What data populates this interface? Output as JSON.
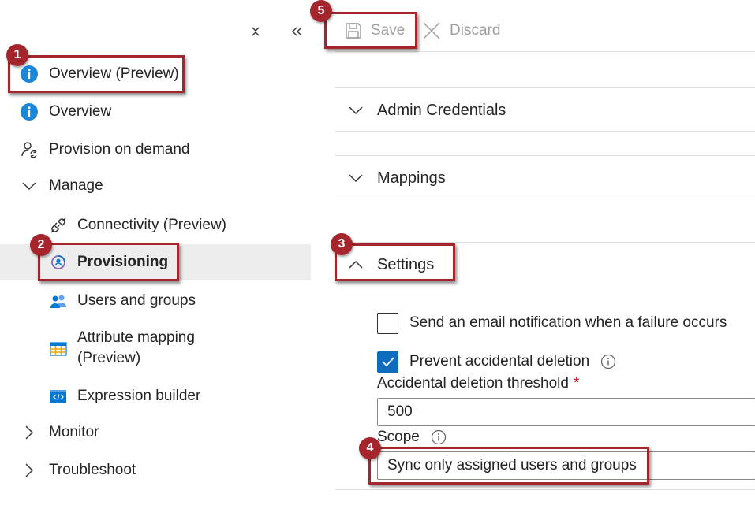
{
  "nav": {
    "items": [
      {
        "label": "Overview (Preview)",
        "icon": "info-icon"
      },
      {
        "label": "Overview",
        "icon": "info-icon"
      },
      {
        "label": "Provision on demand",
        "icon": "provision-on-demand-icon"
      },
      {
        "label": "Manage",
        "icon": "chevron-down-icon"
      },
      {
        "label": "Connectivity (Preview)",
        "icon": "connectivity-plug-icon"
      },
      {
        "label": "Provisioning",
        "icon": "provisioning-icon",
        "selected": true
      },
      {
        "label": "Users and groups",
        "icon": "users-groups-icon"
      },
      {
        "label": "Attribute mapping",
        "label_line2": "(Preview)",
        "icon": "attribute-mapping-table-icon"
      },
      {
        "label": "Expression builder",
        "icon": "expression-builder-icon"
      },
      {
        "label": "Monitor",
        "icon": "chevron-right-icon"
      },
      {
        "label": "Troubleshoot",
        "icon": "chevron-right-icon"
      }
    ]
  },
  "toolbar": {
    "save_label": "Save",
    "discard_label": "Discard"
  },
  "sections": {
    "admin_credentials": "Admin Credentials",
    "mappings": "Mappings",
    "settings": "Settings"
  },
  "settings": {
    "email_notification": {
      "label": "Send an email notification when a failure occurs",
      "checked": false
    },
    "prevent_deletion": {
      "label": "Prevent accidental deletion",
      "checked": true
    },
    "threshold_label": "Accidental deletion threshold",
    "threshold_required_mark": "*",
    "threshold_value": "500",
    "scope_label": "Scope",
    "scope_value": "Sync only assigned users and groups"
  },
  "annotations": [
    "1",
    "2",
    "3",
    "4",
    "5"
  ],
  "colors": {
    "accent": "#0f6cbd",
    "callout": "#a4262c",
    "selected_bg": "#ededed",
    "required": "#c50f1f"
  }
}
